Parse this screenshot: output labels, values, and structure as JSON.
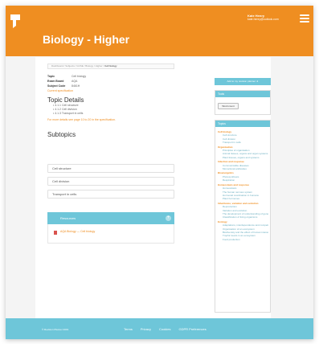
{
  "header": {
    "title": "Biology - Higher",
    "user_name": "Kate Henry",
    "user_email": "kate.henry@outlook.com",
    "brand_color": "#ef8e21",
    "accent_color": "#6ec6d9",
    "logo_icon": "cloud-dot-logo-icon",
    "menu_icon": "hamburger-menu-icon"
  },
  "breadcrumb": {
    "items": [
      "Dashboard",
      "Subjects",
      "GCSE",
      "Biology",
      "Higher"
    ],
    "current": "Cell biology"
  },
  "meta": {
    "topic_label": "Topic",
    "topic_value": "Cell biology",
    "board_label": "Exam Board",
    "board_value": "AQA",
    "code_label": "Subject Code",
    "code_value": "8461H",
    "spec_link": "Current specification"
  },
  "details": {
    "heading": "Topic Details",
    "items": [
      "4.1.1 Cell structure",
      "4.1.2 Cell division",
      "4.1.3 Transport in cells"
    ],
    "note": "For more details see page 10 to 20 in the specification."
  },
  "subtopics": {
    "heading": "Subtopics",
    "items": [
      "Cell structure",
      "Cell division",
      "Transport in cells"
    ]
  },
  "resources": {
    "heading": "Resources",
    "links": [
      "AQA Biology — Cell biology"
    ]
  },
  "sidebar": {
    "add_button": "Add to my revision planner",
    "tools_heading": "Tools",
    "tools_button": "Word count",
    "topics_heading": "Topics",
    "groups": [
      {
        "title": "Cell biology",
        "items": [
          "Cell structure",
          "Cell division",
          "Transport in cells"
        ]
      },
      {
        "title": "Organisation",
        "items": [
          "Principles of organisation",
          "Animal tissues, organs and organ systems",
          "Plant tissues, organs and systems"
        ]
      },
      {
        "title": "Infection and response",
        "items": [
          "Communicable diseases",
          "Monoclonal antibodies"
        ]
      },
      {
        "title": "Bioenergetics",
        "items": [
          "Photosynthesis",
          "Respiration"
        ]
      },
      {
        "title": "Homeostasis and response",
        "items": [
          "Homeostasis",
          "The human nervous system",
          "Hormonal coordination in humans",
          "Plant hormones"
        ]
      },
      {
        "title": "Inheritance, variation and evolution",
        "items": [
          "Reproduction",
          "Variation and evolution",
          "The development of understanding of genetics and evolution",
          "Classification of living organisms"
        ]
      },
      {
        "title": "Ecology",
        "items": [
          "Adaptations, interdependence and competition",
          "Organisation of an ecosystem",
          "Biodiversity and the effect of human interaction on ecosystems",
          "Trophic levels in an ecosystem",
          "Food production"
        ]
      }
    ]
  },
  "footer": {
    "copyright": "© Revision Planner 2019",
    "links": [
      "Terms",
      "Privacy",
      "Cookies",
      "GDPR Preferences"
    ]
  }
}
